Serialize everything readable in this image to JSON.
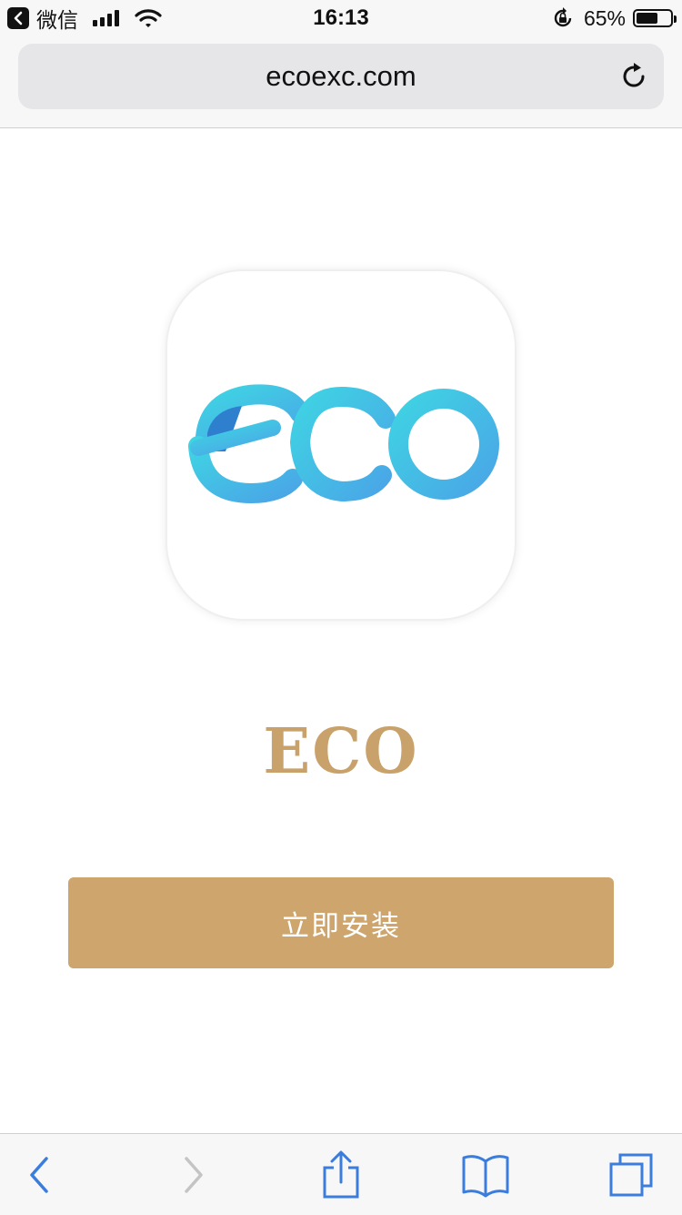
{
  "status_bar": {
    "back_app_label": "微信",
    "time": "16:13",
    "battery_percent": "65%",
    "battery_level": 0.65,
    "signal_bars": 4,
    "icons": [
      "back-app-icon",
      "signal-icon",
      "wifi-icon",
      "rotation-lock-icon",
      "battery-icon"
    ]
  },
  "browser": {
    "url": "ecoexc.com",
    "reload_icon": "reload-icon"
  },
  "app": {
    "logo_text": "eco",
    "name": "ECO",
    "install_label": "立即安装",
    "colors": {
      "accent": "#cda56d",
      "name_color": "#c8a26a",
      "logo_gradient_start": "#3ec9e0",
      "logo_gradient_end": "#4aa8e6",
      "logo_dark": "#2f7fcf"
    }
  },
  "toolbar": {
    "items": [
      "back-icon",
      "forward-icon",
      "share-icon",
      "bookmarks-icon",
      "tabs-icon"
    ],
    "accent": "#3b7ddd",
    "disabled": "#c4c4c4"
  }
}
